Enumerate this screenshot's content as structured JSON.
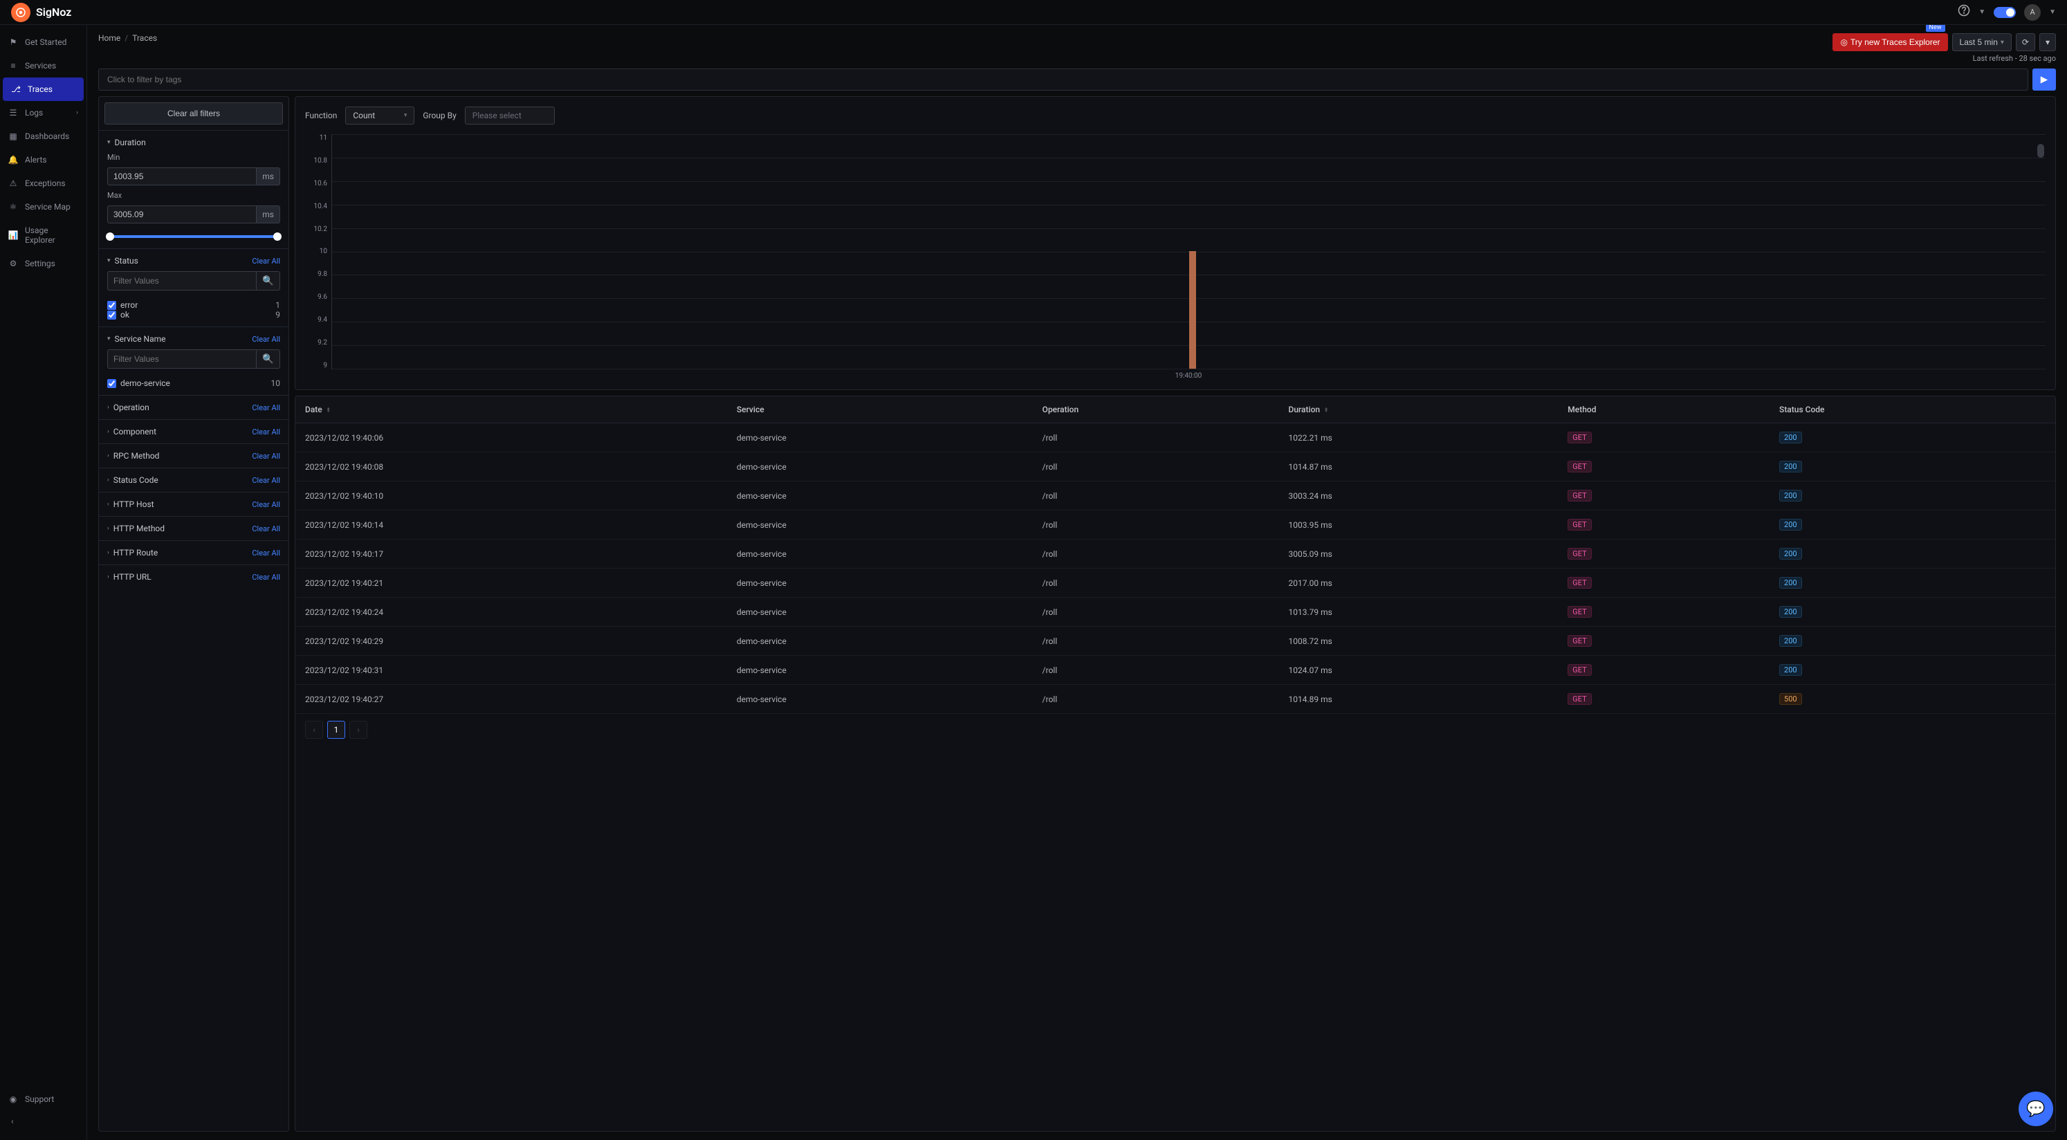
{
  "app": {
    "name": "SigNoz"
  },
  "sidebar": {
    "items": [
      {
        "label": "Get Started",
        "icon": "rocket"
      },
      {
        "label": "Services",
        "icon": "bars"
      },
      {
        "label": "Traces",
        "icon": "branch",
        "active": true
      },
      {
        "label": "Logs",
        "icon": "lines",
        "chevron": true
      },
      {
        "label": "Dashboards",
        "icon": "grid"
      },
      {
        "label": "Alerts",
        "icon": "bell"
      },
      {
        "label": "Exceptions",
        "icon": "warning"
      },
      {
        "label": "Service Map",
        "icon": "share"
      },
      {
        "label": "Usage Explorer",
        "icon": "chart"
      },
      {
        "label": "Settings",
        "icon": "gear"
      }
    ],
    "support": "Support"
  },
  "breadcrumb": {
    "home": "Home",
    "current": "Traces"
  },
  "header": {
    "new_badge": "New",
    "try_button": "Try new Traces Explorer",
    "time_range": "Last 5 min",
    "refresh_text": "Last refresh - 28 sec ago"
  },
  "filter_input": {
    "placeholder": "Click to filter by tags"
  },
  "filters": {
    "clear_all_btn": "Clear all filters",
    "clear_link": "Clear All",
    "duration": {
      "title": "Duration",
      "min_label": "Min",
      "max_label": "Max",
      "min_value": "1003.95",
      "max_value": "3005.09",
      "unit": "ms"
    },
    "status": {
      "title": "Status",
      "search_placeholder": "Filter Values",
      "items": [
        {
          "label": "error",
          "count": 1,
          "checked": true
        },
        {
          "label": "ok",
          "count": 9,
          "checked": true
        }
      ]
    },
    "service_name": {
      "title": "Service Name",
      "search_placeholder": "Filter Values",
      "items": [
        {
          "label": "demo-service",
          "count": 10,
          "checked": true
        }
      ]
    },
    "collapsed": [
      {
        "title": "Operation"
      },
      {
        "title": "Component"
      },
      {
        "title": "RPC Method"
      },
      {
        "title": "Status Code"
      },
      {
        "title": "HTTP Host"
      },
      {
        "title": "HTTP Method"
      },
      {
        "title": "HTTP Route"
      },
      {
        "title": "HTTP URL"
      }
    ]
  },
  "chart": {
    "function_label": "Function",
    "function_value": "Count",
    "groupby_label": "Group By",
    "groupby_placeholder": "Please select"
  },
  "chart_data": {
    "type": "bar",
    "y_ticks": [
      "11",
      "10.8",
      "10.6",
      "10.4",
      "10.2",
      "10",
      "9.8",
      "9.6",
      "9.4",
      "9.2",
      "9"
    ],
    "x_label": "19:40:00",
    "categories": [
      "19:40:00"
    ],
    "values": [
      10
    ],
    "ylim": [
      9,
      11
    ]
  },
  "table": {
    "columns": [
      "Date",
      "Service",
      "Operation",
      "Duration",
      "Method",
      "Status Code"
    ],
    "sortable": [
      true,
      false,
      false,
      true,
      false,
      false
    ],
    "rows": [
      {
        "date": "2023/12/02 19:40:06",
        "service": "demo-service",
        "operation": "/roll",
        "duration": "1022.21 ms",
        "method": "GET",
        "status": "200"
      },
      {
        "date": "2023/12/02 19:40:08",
        "service": "demo-service",
        "operation": "/roll",
        "duration": "1014.87 ms",
        "method": "GET",
        "status": "200"
      },
      {
        "date": "2023/12/02 19:40:10",
        "service": "demo-service",
        "operation": "/roll",
        "duration": "3003.24 ms",
        "method": "GET",
        "status": "200"
      },
      {
        "date": "2023/12/02 19:40:14",
        "service": "demo-service",
        "operation": "/roll",
        "duration": "1003.95 ms",
        "method": "GET",
        "status": "200"
      },
      {
        "date": "2023/12/02 19:40:17",
        "service": "demo-service",
        "operation": "/roll",
        "duration": "3005.09 ms",
        "method": "GET",
        "status": "200"
      },
      {
        "date": "2023/12/02 19:40:21",
        "service": "demo-service",
        "operation": "/roll",
        "duration": "2017.00 ms",
        "method": "GET",
        "status": "200"
      },
      {
        "date": "2023/12/02 19:40:24",
        "service": "demo-service",
        "operation": "/roll",
        "duration": "1013.79 ms",
        "method": "GET",
        "status": "200"
      },
      {
        "date": "2023/12/02 19:40:29",
        "service": "demo-service",
        "operation": "/roll",
        "duration": "1008.72 ms",
        "method": "GET",
        "status": "200"
      },
      {
        "date": "2023/12/02 19:40:31",
        "service": "demo-service",
        "operation": "/roll",
        "duration": "1024.07 ms",
        "method": "GET",
        "status": "200"
      },
      {
        "date": "2023/12/02 19:40:27",
        "service": "demo-service",
        "operation": "/roll",
        "duration": "1014.89 ms",
        "method": "GET",
        "status": "500"
      }
    ],
    "page": "1"
  },
  "avatar_initial": "A"
}
